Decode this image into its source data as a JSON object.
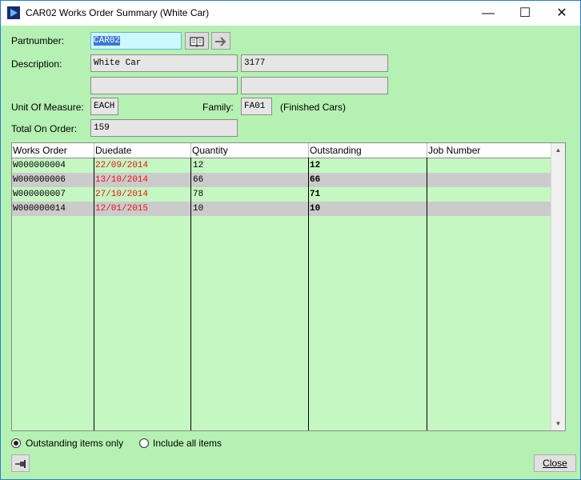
{
  "window": {
    "title": "CAR02 Works Order Summary (White Car)",
    "controls": {
      "minimize": "—",
      "maximize": "☐",
      "close": "✕"
    }
  },
  "form": {
    "partnumber_label": "Partnumber:",
    "partnumber_value": "CAR02",
    "description_label": "Description:",
    "description_1": "White Car",
    "description_code": "3177",
    "description_2": "",
    "description_3": "",
    "uom_label": "Unit Of Measure:",
    "uom_value": "EACH",
    "family_label": "Family:",
    "family_code": "FA01",
    "family_name": "(Finished Cars)",
    "total_label": "Total On Order:",
    "total_value": "159"
  },
  "grid": {
    "columns": [
      "Works Order",
      "Duedate",
      "Quantity",
      "Outstanding",
      "Job Number"
    ],
    "rows": [
      {
        "works_order": "W000000004",
        "duedate": "22/09/2014",
        "quantity": "12",
        "outstanding": "12",
        "job_number": ""
      },
      {
        "works_order": "W000000006",
        "duedate": "13/10/2014",
        "quantity": "66",
        "outstanding": "66",
        "job_number": ""
      },
      {
        "works_order": "W000000007",
        "duedate": "27/10/2014",
        "quantity": "78",
        "outstanding": "71",
        "job_number": ""
      },
      {
        "works_order": "W000000014",
        "duedate": "12/01/2015",
        "quantity": "10",
        "outstanding": "10",
        "job_number": ""
      }
    ]
  },
  "filter": {
    "outstanding_label": "Outstanding items only",
    "all_label": "Include all items",
    "selected": "outstanding"
  },
  "buttons": {
    "close_label": "Close"
  },
  "icons": {
    "lookup": "book-icon",
    "go": "arrow-right-icon",
    "pin": "pin-icon",
    "app": "app-play-icon"
  },
  "colors": {
    "background": "#b5f1b2",
    "grid_background": "#c5f7c2",
    "grid_alt_row": "#cbcbcb",
    "overdue_date": "#ee1111",
    "part_field": "#cdf8ff"
  }
}
